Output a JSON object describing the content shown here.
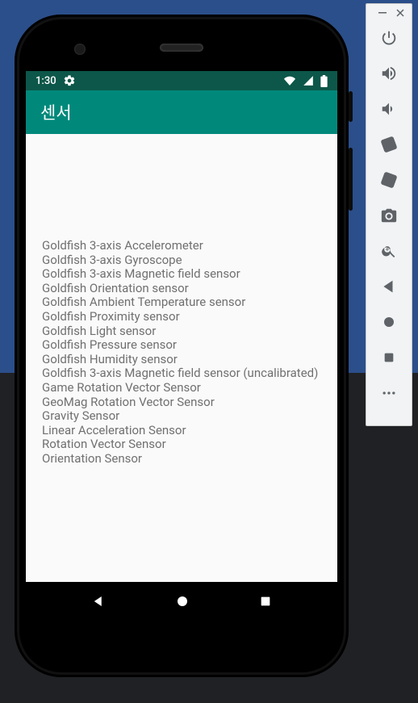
{
  "status": {
    "time": "1:30"
  },
  "appbar": {
    "title": "센서"
  },
  "toolbar_names": [
    "power-icon",
    "volume-up-icon",
    "volume-down-icon",
    "rotate-left-icon",
    "rotate-right-icon",
    "camera-icon",
    "zoom-in-icon",
    "back-icon",
    "home-icon",
    "overview-icon",
    "overflow-icon"
  ],
  "sensors": [
    "Goldfish 3-axis Accelerometer",
    "Goldfish 3-axis Gyroscope",
    "Goldfish 3-axis Magnetic field sensor",
    "Goldfish Orientation sensor",
    "Goldfish Ambient Temperature sensor",
    "Goldfish Proximity sensor",
    "Goldfish Light sensor",
    "Goldfish Pressure sensor",
    "Goldfish Humidity sensor",
    "Goldfish 3-axis Magnetic field sensor (uncalibrated)",
    "Game Rotation Vector Sensor",
    "GeoMag Rotation Vector Sensor",
    "Gravity Sensor",
    "Linear Acceleration Sensor",
    "Rotation Vector Sensor",
    "Orientation Sensor"
  ]
}
